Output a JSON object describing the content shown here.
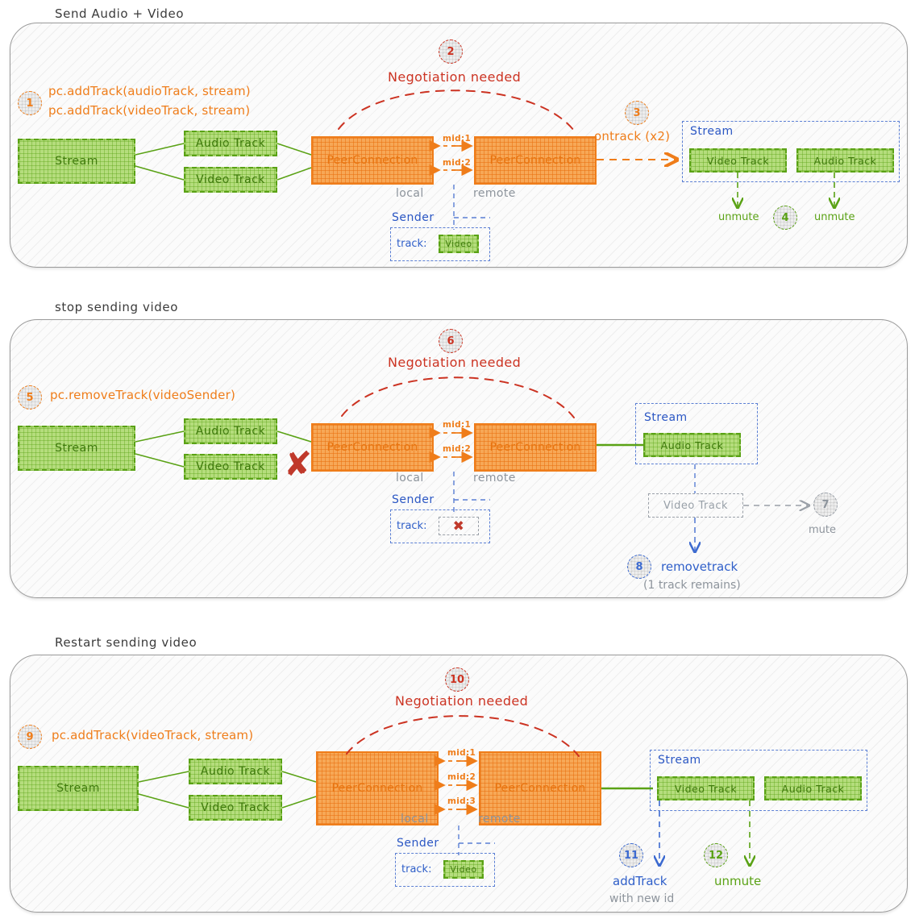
{
  "colors": {
    "orange": "#ef7d1a",
    "green": "#5aa215",
    "red": "#cc3322",
    "blue": "#2f5fc9",
    "grey": "#8d949c",
    "panel_border": "#9a9a9a"
  },
  "panels": [
    {
      "title": "Send Audio + Video",
      "steps": [
        {
          "num": "1",
          "color": "orange"
        },
        {
          "num": "2",
          "color": "red"
        },
        {
          "num": "3",
          "color": "orange"
        },
        {
          "num": "4",
          "color": "green"
        }
      ],
      "code_line_1": "pc.addTrack(audioTrack, stream)",
      "code_line_2": "pc.addTrack(videoTrack, stream)",
      "negotiation": "Negotiation needed",
      "ontrack": "ontrack (x2)",
      "stream_label": "Stream",
      "local_stream": "Stream",
      "tracks_left": [
        "Audio Track",
        "Video Track"
      ],
      "pc_local": "PeerConnection",
      "pc_remote": "PeerConnection",
      "local_label": "local",
      "remote_label": "remote",
      "mids": [
        "mid:1",
        "mid:2"
      ],
      "sender_label": "Sender",
      "sender_track_label": "track:",
      "sender_track_value": "Video",
      "remote_stream_label": "Stream",
      "remote_tracks": [
        "Video Track",
        "Audio Track"
      ],
      "events": [
        "unmute",
        "unmute"
      ]
    },
    {
      "title": "stop sending video",
      "steps": [
        {
          "num": "5",
          "color": "orange"
        },
        {
          "num": "6",
          "color": "red"
        },
        {
          "num": "7",
          "color": "grey"
        },
        {
          "num": "8",
          "color": "blue"
        }
      ],
      "code_line_1": "pc.removeTrack(videoSender)",
      "negotiation": "Negotiation needed",
      "local_stream": "Stream",
      "tracks_left": [
        "Audio Track",
        "Video Track"
      ],
      "pc_local": "PeerConnection",
      "pc_remote": "PeerConnection",
      "local_label": "local",
      "remote_label": "remote",
      "mids": [
        "mid:1",
        "mid:2"
      ],
      "sender_label": "Sender",
      "sender_track_label": "track:",
      "sender_track_value": "✖",
      "remote_stream_label": "Stream",
      "remote_tracks": [
        "Audio Track"
      ],
      "removed_track": "Video Track",
      "mute_label": "mute",
      "removetrack_label": "removetrack",
      "removetrack_sub": "(1 track remains)"
    },
    {
      "title": "Restart sending video",
      "steps": [
        {
          "num": "9",
          "color": "orange"
        },
        {
          "num": "10",
          "color": "red"
        },
        {
          "num": "11",
          "color": "blue"
        },
        {
          "num": "12",
          "color": "green"
        }
      ],
      "code_line_1": "pc.addTrack(videoTrack, stream)",
      "negotiation": "Negotiation needed",
      "local_stream": "Stream",
      "tracks_left": [
        "Audio Track",
        "Video Track"
      ],
      "pc_local": "PeerConnection",
      "pc_remote": "PeerConnection",
      "local_label": "local",
      "remote_label": "remote",
      "mids": [
        "mid:1",
        "mid:2",
        "mid:3"
      ],
      "sender_label": "Sender",
      "sender_track_label": "track:",
      "sender_track_value": "Video",
      "remote_stream_label": "Stream",
      "remote_tracks": [
        "Video Track",
        "Audio Track"
      ],
      "addtrack_label": "addTrack",
      "addtrack_sub": "with new id",
      "unmute_label": "unmute"
    }
  ]
}
